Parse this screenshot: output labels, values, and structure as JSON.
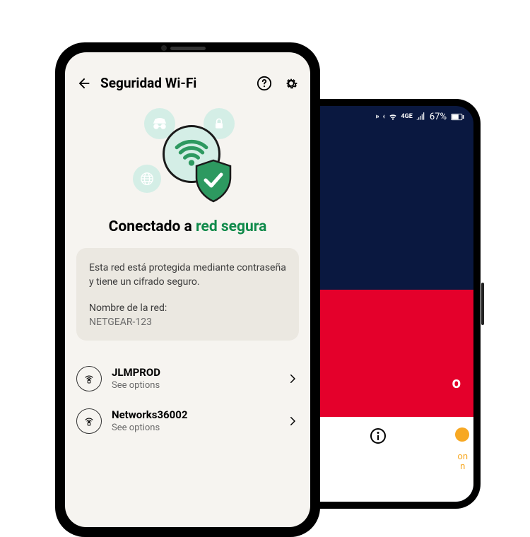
{
  "back_phone": {
    "battery": "67%",
    "partial_text": "o"
  },
  "header": {
    "title": "Seguridad Wi-Fi"
  },
  "status": {
    "prefix": "Conectado a ",
    "highlight": "red segura"
  },
  "info_card": {
    "description": "Esta red está protegida mediante contraseña y tiene un cifrado seguro.",
    "network_label": "Nombre de la red:",
    "network_name": "NETGEAR-123"
  },
  "networks": [
    {
      "name": "JLMPROD",
      "sub": "See options"
    },
    {
      "name": "Networks36002",
      "sub": "See options"
    }
  ]
}
